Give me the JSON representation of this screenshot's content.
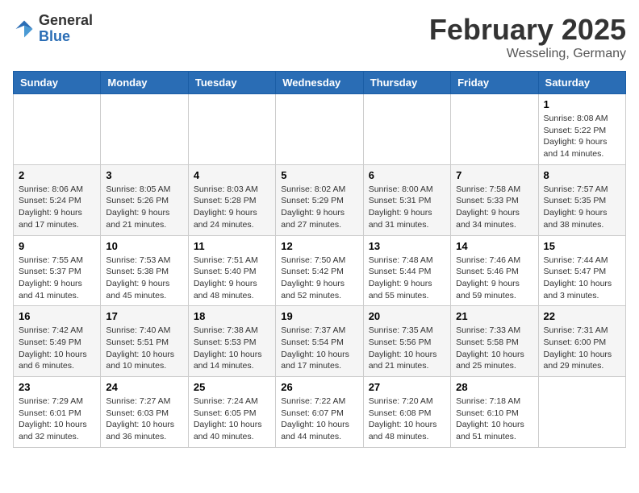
{
  "header": {
    "logo": {
      "general": "General",
      "blue": "Blue"
    },
    "title": "February 2025",
    "location": "Wesseling, Germany"
  },
  "weekdays": [
    "Sunday",
    "Monday",
    "Tuesday",
    "Wednesday",
    "Thursday",
    "Friday",
    "Saturday"
  ],
  "weeks": [
    [
      {
        "day": "",
        "content": ""
      },
      {
        "day": "",
        "content": ""
      },
      {
        "day": "",
        "content": ""
      },
      {
        "day": "",
        "content": ""
      },
      {
        "day": "",
        "content": ""
      },
      {
        "day": "",
        "content": ""
      },
      {
        "day": "1",
        "content": "Sunrise: 8:08 AM\nSunset: 5:22 PM\nDaylight: 9 hours and 14 minutes."
      }
    ],
    [
      {
        "day": "2",
        "content": "Sunrise: 8:06 AM\nSunset: 5:24 PM\nDaylight: 9 hours and 17 minutes."
      },
      {
        "day": "3",
        "content": "Sunrise: 8:05 AM\nSunset: 5:26 PM\nDaylight: 9 hours and 21 minutes."
      },
      {
        "day": "4",
        "content": "Sunrise: 8:03 AM\nSunset: 5:28 PM\nDaylight: 9 hours and 24 minutes."
      },
      {
        "day": "5",
        "content": "Sunrise: 8:02 AM\nSunset: 5:29 PM\nDaylight: 9 hours and 27 minutes."
      },
      {
        "day": "6",
        "content": "Sunrise: 8:00 AM\nSunset: 5:31 PM\nDaylight: 9 hours and 31 minutes."
      },
      {
        "day": "7",
        "content": "Sunrise: 7:58 AM\nSunset: 5:33 PM\nDaylight: 9 hours and 34 minutes."
      },
      {
        "day": "8",
        "content": "Sunrise: 7:57 AM\nSunset: 5:35 PM\nDaylight: 9 hours and 38 minutes."
      }
    ],
    [
      {
        "day": "9",
        "content": "Sunrise: 7:55 AM\nSunset: 5:37 PM\nDaylight: 9 hours and 41 minutes."
      },
      {
        "day": "10",
        "content": "Sunrise: 7:53 AM\nSunset: 5:38 PM\nDaylight: 9 hours and 45 minutes."
      },
      {
        "day": "11",
        "content": "Sunrise: 7:51 AM\nSunset: 5:40 PM\nDaylight: 9 hours and 48 minutes."
      },
      {
        "day": "12",
        "content": "Sunrise: 7:50 AM\nSunset: 5:42 PM\nDaylight: 9 hours and 52 minutes."
      },
      {
        "day": "13",
        "content": "Sunrise: 7:48 AM\nSunset: 5:44 PM\nDaylight: 9 hours and 55 minutes."
      },
      {
        "day": "14",
        "content": "Sunrise: 7:46 AM\nSunset: 5:46 PM\nDaylight: 9 hours and 59 minutes."
      },
      {
        "day": "15",
        "content": "Sunrise: 7:44 AM\nSunset: 5:47 PM\nDaylight: 10 hours and 3 minutes."
      }
    ],
    [
      {
        "day": "16",
        "content": "Sunrise: 7:42 AM\nSunset: 5:49 PM\nDaylight: 10 hours and 6 minutes."
      },
      {
        "day": "17",
        "content": "Sunrise: 7:40 AM\nSunset: 5:51 PM\nDaylight: 10 hours and 10 minutes."
      },
      {
        "day": "18",
        "content": "Sunrise: 7:38 AM\nSunset: 5:53 PM\nDaylight: 10 hours and 14 minutes."
      },
      {
        "day": "19",
        "content": "Sunrise: 7:37 AM\nSunset: 5:54 PM\nDaylight: 10 hours and 17 minutes."
      },
      {
        "day": "20",
        "content": "Sunrise: 7:35 AM\nSunset: 5:56 PM\nDaylight: 10 hours and 21 minutes."
      },
      {
        "day": "21",
        "content": "Sunrise: 7:33 AM\nSunset: 5:58 PM\nDaylight: 10 hours and 25 minutes."
      },
      {
        "day": "22",
        "content": "Sunrise: 7:31 AM\nSunset: 6:00 PM\nDaylight: 10 hours and 29 minutes."
      }
    ],
    [
      {
        "day": "23",
        "content": "Sunrise: 7:29 AM\nSunset: 6:01 PM\nDaylight: 10 hours and 32 minutes."
      },
      {
        "day": "24",
        "content": "Sunrise: 7:27 AM\nSunset: 6:03 PM\nDaylight: 10 hours and 36 minutes."
      },
      {
        "day": "25",
        "content": "Sunrise: 7:24 AM\nSunset: 6:05 PM\nDaylight: 10 hours and 40 minutes."
      },
      {
        "day": "26",
        "content": "Sunrise: 7:22 AM\nSunset: 6:07 PM\nDaylight: 10 hours and 44 minutes."
      },
      {
        "day": "27",
        "content": "Sunrise: 7:20 AM\nSunset: 6:08 PM\nDaylight: 10 hours and 48 minutes."
      },
      {
        "day": "28",
        "content": "Sunrise: 7:18 AM\nSunset: 6:10 PM\nDaylight: 10 hours and 51 minutes."
      },
      {
        "day": "",
        "content": ""
      }
    ]
  ]
}
